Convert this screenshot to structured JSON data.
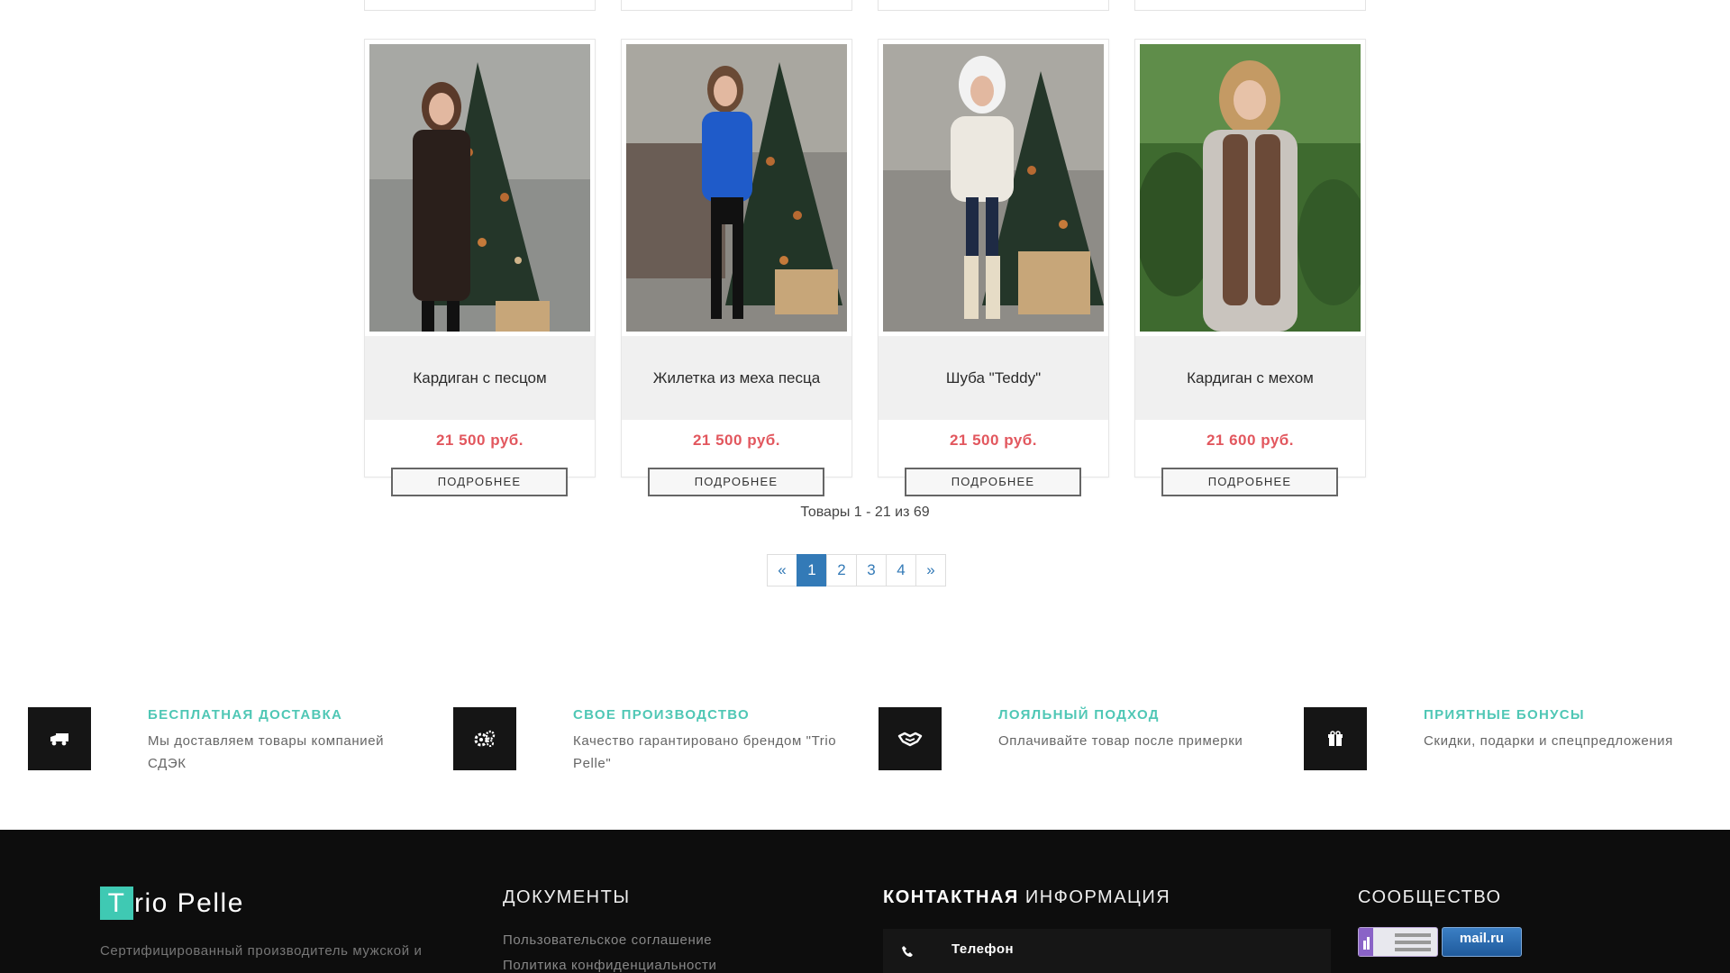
{
  "products": [
    {
      "name": "Кардиган с песцом",
      "price": "21 500 руб.",
      "button": "ПОДРОБНЕЕ"
    },
    {
      "name": "Жилетка из меха песца",
      "price": "21 500 руб.",
      "button": "ПОДРОБНЕЕ"
    },
    {
      "name": "Шуба \"Teddy\"",
      "price": "21 500 руб.",
      "button": "ПОДРОБНЕЕ"
    },
    {
      "name": "Кардиган с мехом",
      "price": "21 600 руб.",
      "button": "ПОДРОБНЕЕ"
    }
  ],
  "listing": {
    "counter": "Товары 1 - 21 из 69"
  },
  "pagination": {
    "prev": "«",
    "pages": [
      "1",
      "2",
      "3",
      "4"
    ],
    "current": "1",
    "next": "»"
  },
  "features": [
    {
      "icon": "truck-icon",
      "title": "БЕСПЛАТНАЯ ДОСТАВКА",
      "text": "Мы доставляем товары компанией СДЭК"
    },
    {
      "icon": "gears-icon",
      "title": "СВОЕ ПРОИЗВОДСТВО",
      "text": "Качество гарантировано брендом \"Trio Pelle\""
    },
    {
      "icon": "handshake-icon",
      "title": "ЛОЯЛЬНЫЙ ПОДХОД",
      "text": "Оплачивайте товар после примерки"
    },
    {
      "icon": "gift-icon",
      "title": "ПРИЯТНЫЕ БОНУСЫ",
      "text": "Скидки, подарки и спецпредложения"
    }
  ],
  "footer": {
    "logo_letter": "T",
    "logo_rest": "rio Pelle",
    "about": "Сертифицированный производитель мужской и",
    "documents": {
      "heading": "ДОКУМЕНТЫ",
      "links": [
        "Пользовательское соглашение",
        "Политика конфиденциальности"
      ]
    },
    "contacts": {
      "heading_bold": "КОНТАКТНАЯ",
      "heading_rest": "ИНФОРМАЦИЯ",
      "phone_label": "Телефон"
    },
    "community": {
      "heading": "СООБЩЕСТВО",
      "mailru_label": "mail.ru"
    }
  },
  "colors": {
    "accent": "#4fc7b5",
    "price": "#e2575e",
    "pager": "#337ab7",
    "footer_bg": "#0d0d0d"
  }
}
